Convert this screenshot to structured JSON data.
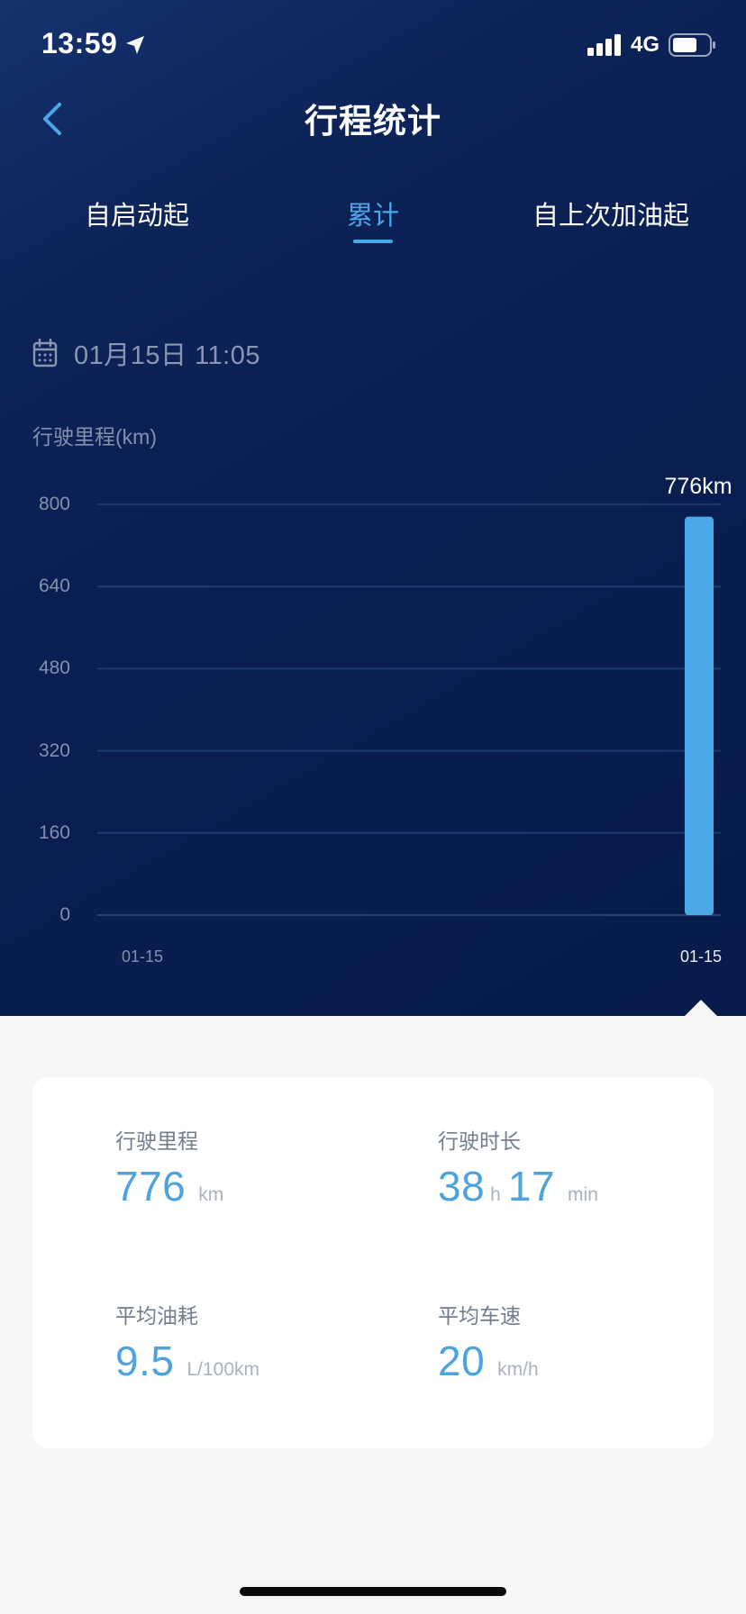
{
  "status_bar": {
    "time": "13:59",
    "network": "4G",
    "icons": [
      "location-arrow-icon",
      "signal-icon",
      "battery-icon"
    ]
  },
  "nav": {
    "title": "行程统计",
    "back_icon": "chevron-left-icon"
  },
  "tabs": [
    {
      "label": "自启动起",
      "active": false
    },
    {
      "label": "累计",
      "active": true
    },
    {
      "label": "自上次加油起",
      "active": false
    }
  ],
  "date": {
    "icon": "calendar-icon",
    "text": "01月15日 11:05"
  },
  "colors": {
    "accent": "#4ba8e8",
    "bar": "#4aa9e6",
    "background_top": "#0a1f52",
    "panel": "#f4f6f8"
  },
  "chart_data": {
    "type": "bar",
    "ylabel": "行驶里程(km)",
    "ylim": [
      0,
      800
    ],
    "yticks": [
      "800",
      "640",
      "480",
      "320",
      "160",
      "0"
    ],
    "x_tick_labels": [
      "01-15",
      "01-15"
    ],
    "categories": [
      "01-15"
    ],
    "values": [
      776
    ],
    "data_labels": [
      "776km"
    ],
    "grid": true
  },
  "stats": {
    "distance": {
      "label": "行驶里程",
      "value": "776",
      "unit": "km"
    },
    "duration": {
      "label": "行驶时长",
      "hours": "38",
      "hours_unit": "h",
      "minutes": "17",
      "minutes_unit": "min"
    },
    "fuel": {
      "label": "平均油耗",
      "value": "9.5",
      "unit": "L/100km"
    },
    "speed": {
      "label": "平均车速",
      "value": "20",
      "unit": "km/h"
    }
  }
}
